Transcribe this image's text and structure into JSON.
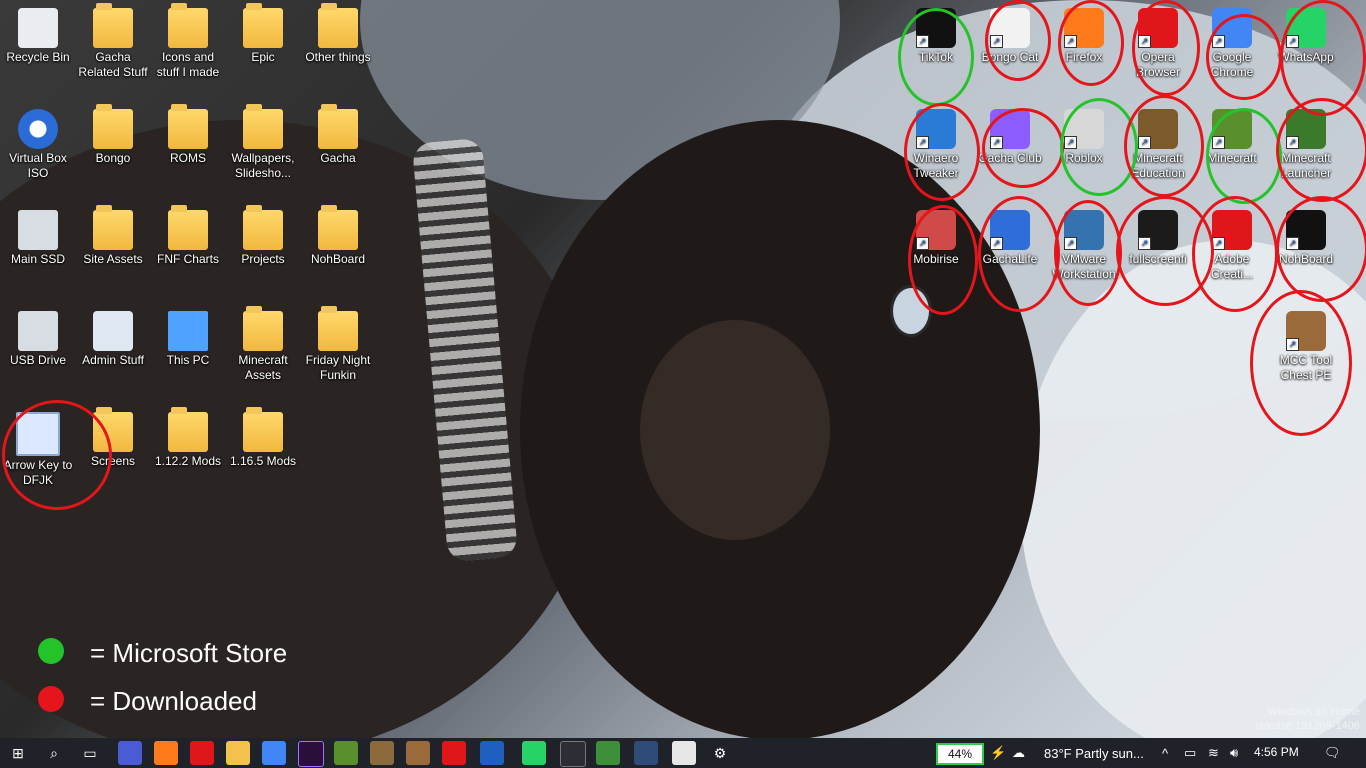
{
  "desktop": {
    "left_icons": [
      {
        "label": "Recycle Bin",
        "type": "recycle-bin-icon"
      },
      {
        "label": "Gacha Related Stuff",
        "type": "folder-icon"
      },
      {
        "label": "Icons and stuff I made",
        "type": "folder-icon"
      },
      {
        "label": "Epic",
        "type": "folder-icon"
      },
      {
        "label": "Other things",
        "type": "folder-icon"
      },
      {
        "label": "Virtual Box ISO",
        "type": "disc-icon"
      },
      {
        "label": "Bongo",
        "type": "folder-icon"
      },
      {
        "label": "ROMS",
        "type": "folder-icon"
      },
      {
        "label": "Wallpapers, Slidesho...",
        "type": "folder-icon"
      },
      {
        "label": "Gacha",
        "type": "folder-icon"
      },
      {
        "label": "Main SSD",
        "type": "drive-icon"
      },
      {
        "label": "Site Assets",
        "type": "folder-icon"
      },
      {
        "label": "FNF Charts",
        "type": "folder-icon"
      },
      {
        "label": "Projects",
        "type": "folder-icon"
      },
      {
        "label": "NohBoard",
        "type": "folder-icon"
      },
      {
        "label": "USB Drive",
        "type": "usb-drive-icon"
      },
      {
        "label": "Admin Stuff",
        "type": "settings-icon"
      },
      {
        "label": "This PC",
        "type": "pc-icon"
      },
      {
        "label": "Minecraft Assets",
        "type": "folder-icon"
      },
      {
        "label": "Friday Night Funkin",
        "type": "folder-icon"
      },
      {
        "label": "Arrow Key to DFJK",
        "type": "app-h-icon"
      },
      {
        "label": "Screens",
        "type": "folder-icon"
      },
      {
        "label": "1.12.2 Mods",
        "type": "folder-icon"
      },
      {
        "label": "1.16.5 Mods",
        "type": "folder-icon"
      }
    ],
    "right_icons": [
      {
        "label": "TikTok",
        "color": "#111111"
      },
      {
        "label": "Bongo Cat",
        "color": "#f2f2f2"
      },
      {
        "label": "Firefox",
        "color": "#ff7a1a"
      },
      {
        "label": "Opera Browser",
        "color": "#e0161b"
      },
      {
        "label": "Google Chrome",
        "color": "#4285f4"
      },
      {
        "label": "WhatsApp",
        "color": "#25d366"
      },
      {
        "label": "Winaero Tweaker",
        "color": "#2a7bd6"
      },
      {
        "label": "Gacha Club",
        "color": "#8d5cff"
      },
      {
        "label": "Roblox",
        "color": "#d7d7d7"
      },
      {
        "label": "Minecraft Education",
        "color": "#7b5a2c"
      },
      {
        "label": "Minecraft",
        "color": "#5a8f2d"
      },
      {
        "label": "Minecraft Launcher",
        "color": "#3a7a2a"
      },
      {
        "label": "Mobirise",
        "color": "#d14a4a"
      },
      {
        "label": "GachaLife",
        "color": "#2f6dd8"
      },
      {
        "label": "VMware Workstation",
        "color": "#3572b0"
      },
      {
        "label": "fullscreenfi",
        "color": "#1b1b1b"
      },
      {
        "label": "Adobe Creati...",
        "color": "#e0161b"
      },
      {
        "label": "NohBoard",
        "color": "#111111"
      },
      {
        "label": "MCC Tool Chest PE",
        "color": "#9b6a3a"
      }
    ]
  },
  "legend": {
    "store_text": "= Microsoft Store",
    "downloaded_text": "= Downloaded",
    "store_color": "#25c32a",
    "downloaded_color": "#e4151b"
  },
  "taskbar": {
    "battery_percent": "44%",
    "weather": "83°F  Partly sun...",
    "time": "4:56 PM"
  },
  "watermark": {
    "line1": "Windows 10 Home",
    "line2": "release 191206-1406"
  }
}
